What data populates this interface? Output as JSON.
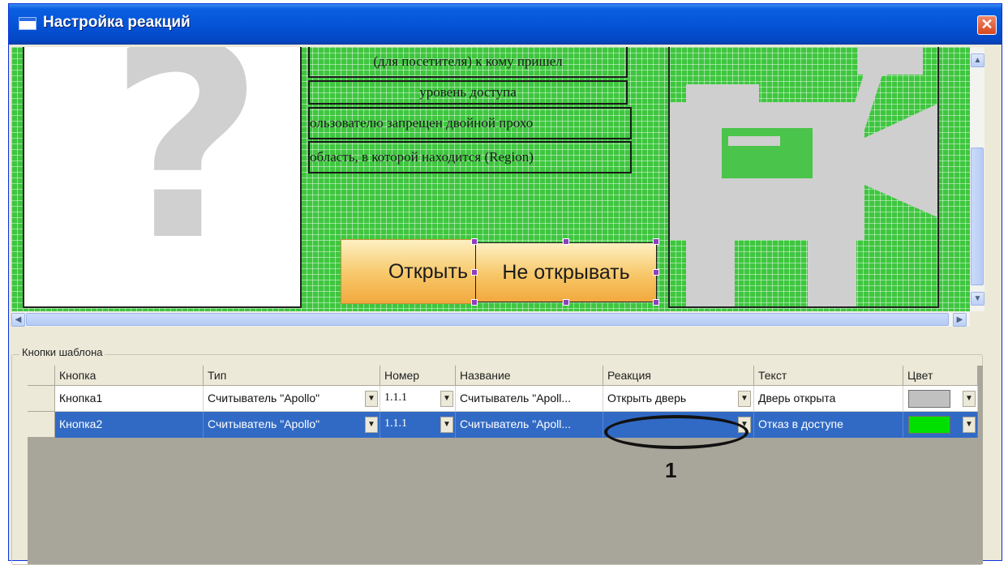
{
  "window": {
    "title": "Настройка реакций",
    "close_label": "✕"
  },
  "layout_preview": {
    "photo_placeholder": "?",
    "fields": [
      "(для посетителя) к кому пришел",
      "уровень доступа",
      "ользователю запрещен двойной прохо",
      "область, в которой находится (Region)"
    ],
    "buttons": [
      "Открыть",
      "Не открывать"
    ]
  },
  "group_label": "Кнопки шаблона",
  "table": {
    "columns": [
      "Кнопка",
      "Тип",
      "Номер",
      "Название",
      "Реакция",
      "Текст",
      "Цвет"
    ],
    "rows": [
      {
        "button": "Кнопка1",
        "type": "Считыватель \"Apollo\"",
        "number": "1.1.1",
        "name": "Считыватель \"Apoll...",
        "reaction": "Открыть дверь",
        "text": "Дверь открыта",
        "color": "#c0c0c0"
      },
      {
        "button": "Кнопка2",
        "type": "Считыватель \"Apollo\"",
        "number": "1.1.1",
        "name": "Считыватель \"Apoll...",
        "reaction": "",
        "text": "Отказ в доступе",
        "color": "#00e000"
      }
    ],
    "selected_row": 2
  },
  "annotation": {
    "label": "1"
  }
}
